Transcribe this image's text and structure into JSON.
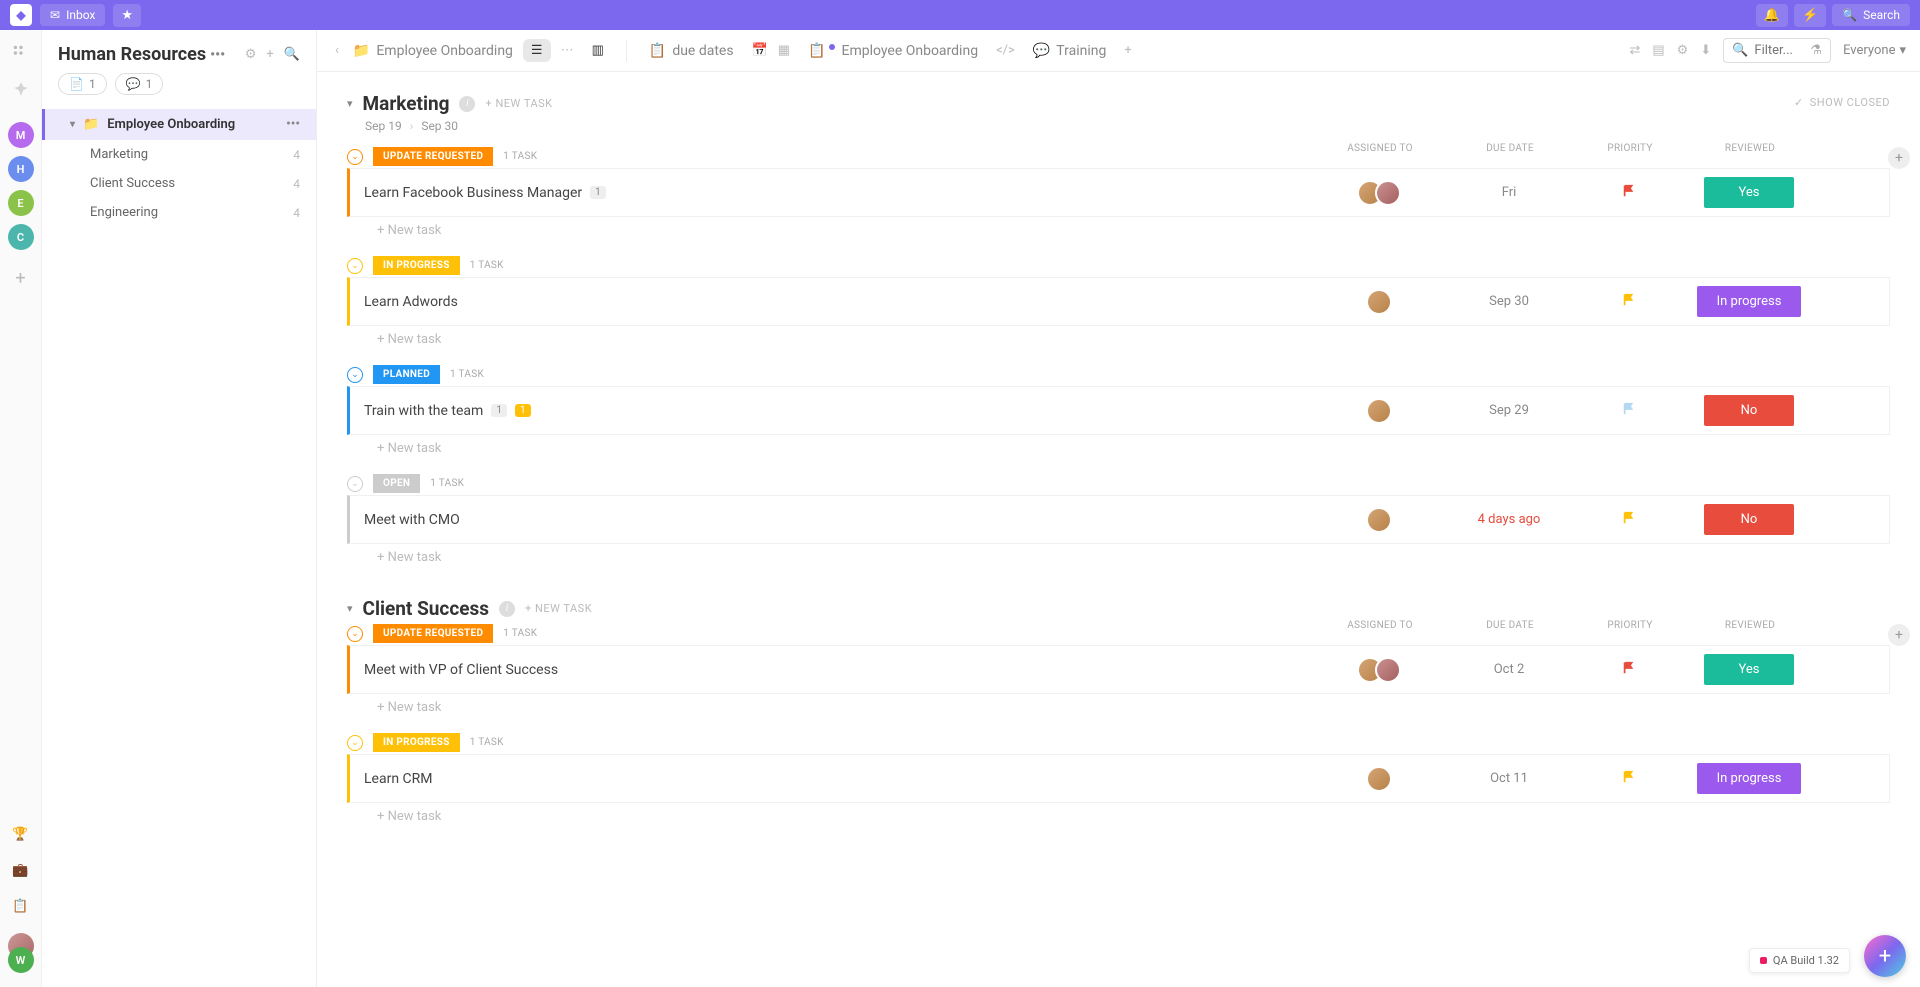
{
  "topbar": {
    "inbox_label": "Inbox",
    "search_label": "Search"
  },
  "sidebar": {
    "title": "Human Resources",
    "doc_count": "1",
    "chat_count": "1",
    "items": [
      {
        "label": "Employee Onboarding"
      }
    ],
    "subitems": [
      {
        "label": "Marketing",
        "count": "4"
      },
      {
        "label": "Client Success",
        "count": "4"
      },
      {
        "label": "Engineering",
        "count": "4"
      }
    ]
  },
  "rail": {
    "avatars": [
      {
        "letter": "M",
        "color": "#b66bee"
      },
      {
        "letter": "H",
        "color": "#6b8eee"
      },
      {
        "letter": "E",
        "color": "#8bc34a"
      },
      {
        "letter": "C",
        "color": "#4db6ac"
      }
    ]
  },
  "views": {
    "crumb_label": "Employee Onboarding",
    "tabs": [
      {
        "label": "due dates",
        "icon": "calendar-list"
      },
      {
        "label": "Employee Onboarding",
        "icon": "list",
        "dot": true
      },
      {
        "label": "Training",
        "icon": "chat"
      }
    ],
    "filter_placeholder": "Filter...",
    "everyone_label": "Everyone"
  },
  "columns": {
    "assigned": "ASSIGNED TO",
    "due": "DUE DATE",
    "priority": "PRIORITY",
    "reviewed": "REVIEWED"
  },
  "labels": {
    "new_task_caps": "+ NEW TASK",
    "new_task": "+ New task",
    "show_closed": "SHOW CLOSED",
    "one_task": "1 TASK"
  },
  "statuses": {
    "update_requested": {
      "label": "UPDATE REQUESTED",
      "color": "#ff8c00"
    },
    "in_progress": {
      "label": "IN PROGRESS",
      "color": "#ffc107"
    },
    "planned": {
      "label": "PLANNED",
      "color": "#2196f3"
    },
    "open": {
      "label": "OPEN",
      "color": "#cccccc"
    }
  },
  "reviewed_values": {
    "yes": {
      "label": "Yes",
      "color": "#1abc9c"
    },
    "in_progress": {
      "label": "In progress",
      "color": "#9b59ee"
    },
    "no": {
      "label": "No",
      "color": "#e74c3c"
    }
  },
  "flag_colors": {
    "red": "#e74c3c",
    "yellow": "#ffc107",
    "blue": "#b3d9f2"
  },
  "sections": [
    {
      "title": "Marketing",
      "start_date": "Sep 19",
      "end_date": "Sep 30",
      "groups": [
        {
          "status": "update_requested",
          "tasks": [
            {
              "name": "Learn Facebook Business Manager",
              "badges": [
                {
                  "text": "1",
                  "type": "grey"
                }
              ],
              "assignees": 2,
              "due": "Fri",
              "overdue": false,
              "flag": "red",
              "reviewed": "yes"
            }
          ]
        },
        {
          "status": "in_progress",
          "tasks": [
            {
              "name": "Learn Adwords",
              "badges": [],
              "assignees": 1,
              "due": "Sep 30",
              "overdue": false,
              "flag": "yellow",
              "reviewed": "in_progress"
            }
          ]
        },
        {
          "status": "planned",
          "tasks": [
            {
              "name": "Train with the team",
              "badges": [
                {
                  "text": "1",
                  "type": "grey"
                },
                {
                  "text": "1",
                  "type": "yellow"
                }
              ],
              "assignees": 1,
              "due": "Sep 29",
              "overdue": false,
              "flag": "blue",
              "reviewed": "no"
            }
          ]
        },
        {
          "status": "open",
          "tasks": [
            {
              "name": "Meet with CMO",
              "badges": [],
              "assignees": 1,
              "due": "4 days ago",
              "overdue": true,
              "flag": "yellow",
              "reviewed": "no"
            }
          ]
        }
      ]
    },
    {
      "title": "Client Success",
      "start_date": "",
      "end_date": "",
      "groups": [
        {
          "status": "update_requested",
          "tasks": [
            {
              "name": "Meet with VP of Client Success",
              "badges": [],
              "assignees": 2,
              "due": "Oct 2",
              "overdue": false,
              "flag": "red",
              "reviewed": "yes"
            }
          ]
        },
        {
          "status": "in_progress",
          "tasks": [
            {
              "name": "Learn CRM",
              "badges": [],
              "assignees": 1,
              "due": "Oct 11",
              "overdue": false,
              "flag": "yellow",
              "reviewed": "in_progress"
            }
          ]
        }
      ]
    }
  ],
  "qa_build": "QA Build 1.32",
  "avatar_gradients": [
    "linear-gradient(135deg,#d4a574,#b8824a)",
    "linear-gradient(135deg,#c99090,#a66060)",
    "linear-gradient(135deg,#8a9a6a,#6a7a4a)"
  ]
}
